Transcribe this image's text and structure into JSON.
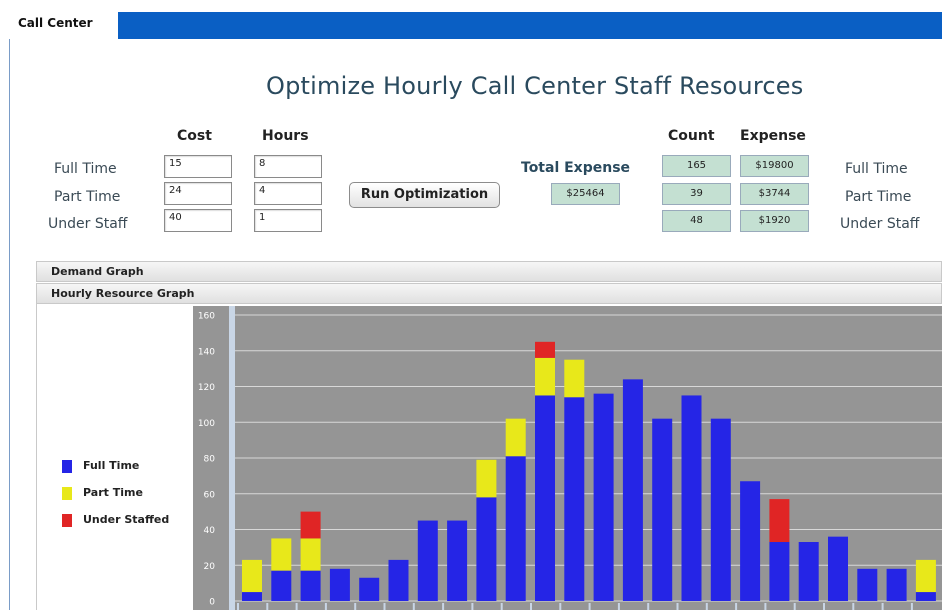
{
  "tab": {
    "label": "Call Center"
  },
  "title": "Optimize Hourly Call Center Staff Resources",
  "inputs": {
    "cost_header": "Cost",
    "hours_header": "Hours",
    "rows": [
      {
        "label": "Full Time",
        "cost": "15",
        "hours": "8"
      },
      {
        "label": "Part Time",
        "cost": "24",
        "hours": "4"
      },
      {
        "label": "Under Staff",
        "cost": "40",
        "hours": "1"
      }
    ]
  },
  "run_button": "Run Optimization",
  "total": {
    "label": "Total Expense",
    "value": "$25464"
  },
  "results": {
    "count_header": "Count",
    "expense_header": "Expense",
    "rows": [
      {
        "label": "Full Time",
        "count": "165",
        "expense": "$19800"
      },
      {
        "label": "Part Time",
        "count": "39",
        "expense": "$3744"
      },
      {
        "label": "Under Staff",
        "count": "48",
        "expense": "$1920"
      }
    ]
  },
  "sections": {
    "demand": "Demand Graph",
    "hourly": "Hourly Resource Graph"
  },
  "legend": [
    {
      "label": "Full Time",
      "color": "#2525e6"
    },
    {
      "label": "Part Time",
      "color": "#e8e81a"
    },
    {
      "label": "Under Staffed",
      "color": "#e02525"
    }
  ],
  "chart_data": {
    "type": "bar",
    "stacked": true,
    "ylim": [
      0,
      160
    ],
    "yticks": [
      0,
      20,
      40,
      60,
      80,
      100,
      120,
      140,
      160
    ],
    "grid": true,
    "legend_position": "left",
    "series": [
      {
        "name": "Full Time",
        "color": "#2525e6",
        "values": [
          5,
          17,
          17,
          18,
          13,
          23,
          45,
          45,
          58,
          81,
          115,
          114,
          116,
          124,
          102,
          115,
          102,
          67,
          33,
          33,
          36,
          18,
          18,
          5
        ]
      },
      {
        "name": "Part Time",
        "color": "#e8e81a",
        "values": [
          18,
          18,
          18,
          0,
          0,
          0,
          0,
          0,
          21,
          21,
          21,
          21,
          0,
          0,
          0,
          0,
          0,
          0,
          0,
          0,
          0,
          0,
          0,
          18
        ]
      },
      {
        "name": "Under Staffed",
        "color": "#e02525",
        "values": [
          0,
          0,
          15,
          0,
          0,
          0,
          0,
          0,
          0,
          0,
          9,
          0,
          0,
          0,
          0,
          0,
          0,
          0,
          24,
          0,
          0,
          0,
          0,
          0
        ]
      }
    ]
  }
}
